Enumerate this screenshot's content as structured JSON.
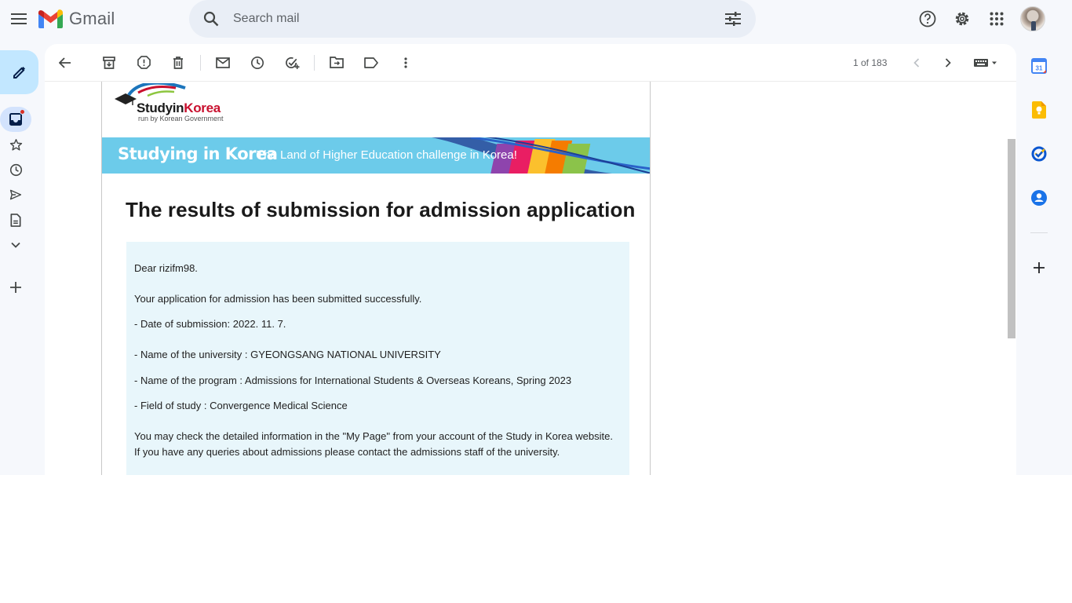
{
  "app": {
    "name": "Gmail"
  },
  "search": {
    "placeholder": "Search mail"
  },
  "pager": {
    "text": "1 of 183"
  },
  "email": {
    "logo_study": "Studyin",
    "logo_korea": "Korea",
    "logo_subtitle": "run by Korean Government",
    "banner_title": "Studying in Korea",
    "banner_subtitle": "The Land of Higher Education challenge in Korea!",
    "title": "The results of submission for admission application",
    "lines": [
      "Dear rizifm98.",
      "Your application for admission has been submitted successfully.",
      "- Date of submission: 2022. 11. 7.",
      "- Name of the university : GYEONGSANG NATIONAL UNIVERSITY",
      "- Name of the program : Admissions for International Students & Overseas Koreans, Spring 2023",
      "- Field of study : Convergence Medical Science",
      "You may check the detailed information in the \"My Page\" from your account of the Study in Korea website.",
      "If you have any queries about admissions please contact the admissions staff of the university."
    ]
  },
  "colors": {
    "compose_bg": "#c2e7ff",
    "search_bg": "#e9eef6",
    "banner_bg": "#6ccbea",
    "message_bg": "#e8f6fb",
    "inbox_badge": "#d93025"
  },
  "icons": {
    "header": [
      "menu-icon",
      "gmail-logo-icon",
      "search-icon",
      "search-options-icon",
      "help-icon",
      "settings-icon",
      "apps-icon",
      "avatar"
    ],
    "left_nav": [
      "compose-icon",
      "inbox-icon",
      "star-icon",
      "snoozed-icon",
      "sent-icon",
      "drafts-icon",
      "more-icon",
      "add-label-icon"
    ],
    "toolbar": [
      "back-icon",
      "archive-icon",
      "report-spam-icon",
      "delete-icon",
      "mark-unread-icon",
      "snooze-icon",
      "add-to-tasks-icon",
      "move-to-icon",
      "label-icon",
      "more-options-icon",
      "older-icon",
      "newer-icon",
      "keyboard-icon"
    ],
    "right_panel": [
      "calendar-icon",
      "keep-icon",
      "tasks-icon",
      "contacts-icon",
      "add-addon-icon"
    ]
  }
}
